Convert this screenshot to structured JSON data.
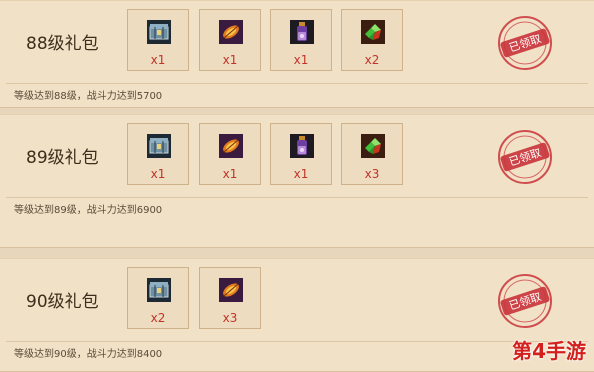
{
  "gifts": [
    {
      "title": "88级礼包",
      "requirement": "等级达到88级，战斗力达到5700",
      "items": [
        {
          "icon": "chest-icon",
          "count": "x1"
        },
        {
          "icon": "flame-feather-icon",
          "count": "x1"
        },
        {
          "icon": "potion-bottle-icon",
          "count": "x1"
        },
        {
          "icon": "green-gem-icon",
          "count": "x2"
        }
      ],
      "stamp": "已领取"
    },
    {
      "title": "89级礼包",
      "requirement": "等级达到89级，战斗力达到6900",
      "items": [
        {
          "icon": "chest-icon",
          "count": "x1"
        },
        {
          "icon": "flame-feather-icon",
          "count": "x1"
        },
        {
          "icon": "potion-bottle-icon",
          "count": "x1"
        },
        {
          "icon": "green-gem-icon",
          "count": "x3"
        }
      ],
      "stamp": "已领取"
    },
    {
      "title": "90级礼包",
      "requirement": "等级达到90级，战斗力达到8400",
      "items": [
        {
          "icon": "chest-icon",
          "count": "x2"
        },
        {
          "icon": "flame-feather-icon",
          "count": "x3"
        }
      ],
      "stamp": "已领取"
    }
  ],
  "watermark": "第4手游",
  "colors": {
    "stamp_red": "#c9333a",
    "count_red": "#c0342a",
    "panel_bg": "#f1e1c6"
  }
}
